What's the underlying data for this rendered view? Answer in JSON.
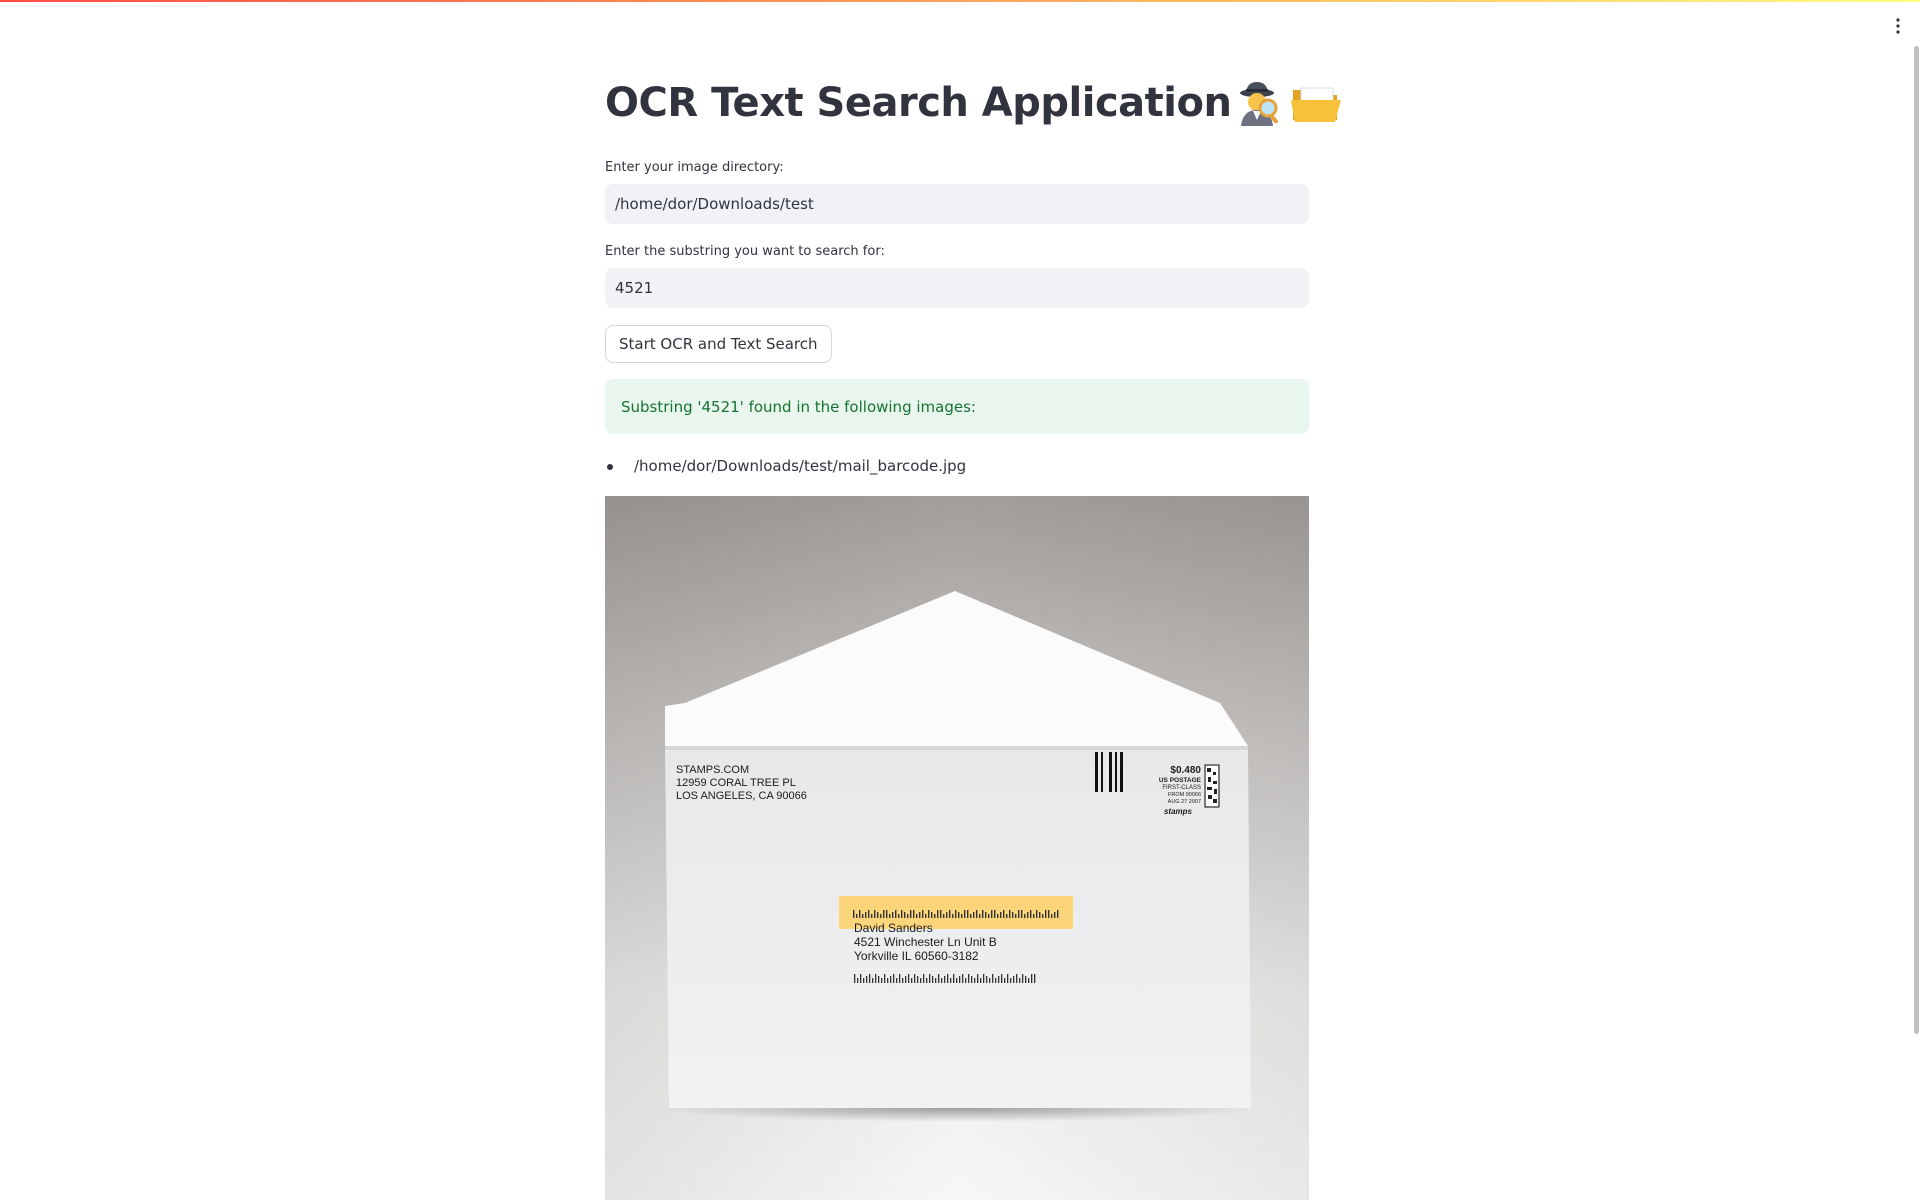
{
  "app": {
    "title": "OCR Text Search Application",
    "title_icons": [
      "detective-icon",
      "open-folder-icon"
    ],
    "accent_gradient": [
      "#ff4b4b",
      "#ff9a55",
      "#fffd80"
    ]
  },
  "form": {
    "directory": {
      "label": "Enter your image directory:",
      "value": "/home/dor/Downloads/test"
    },
    "substring": {
      "label": "Enter the substring you want to search for:",
      "value": "4521"
    },
    "start_button_label": "Start OCR and Text Search"
  },
  "result": {
    "message": "Substring '4521' found in the following images:",
    "message_color": "#177233",
    "message_bg": "#e9f6ee",
    "files": [
      "/home/dor/Downloads/test/mail_barcode.jpg"
    ]
  },
  "envelope": {
    "sender": [
      "STAMPS.COM",
      "12959 CORAL TREE PL",
      "LOS ANGELES, CA 90066"
    ],
    "postage": [
      "$0.480",
      "US POSTAGE",
      "FIRST-CLASS",
      "FROM 90066",
      "AUG 27 2007"
    ],
    "postage_brand": "stamps",
    "recipient": [
      "David Sanders",
      "4521 Winchester Ln Unit B",
      "Yorkville IL 60560-3182"
    ],
    "label_color": "#fcd57a"
  }
}
